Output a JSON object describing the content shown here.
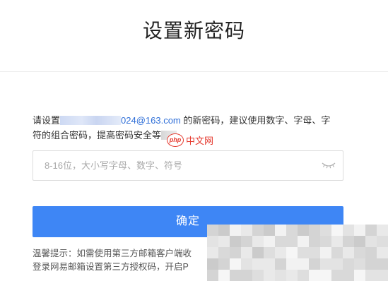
{
  "header": {
    "title": "设置新密码"
  },
  "description": {
    "prefix": "请设置",
    "email_visible_tail": "024@163.com",
    "line1_suffix": " 的新密码，建议使用数字、字母、字",
    "line2_text": "符的组合密码，提高密码安全等"
  },
  "watermark": {
    "logo": "php",
    "text": "中文网"
  },
  "password_field": {
    "placeholder": "8-16位，大小写字母、数字、符号",
    "value": "",
    "toggle_icon": "eye-closed-icon"
  },
  "confirm_button": {
    "label": "确定",
    "color": "#3e86f5"
  },
  "tip": {
    "line1": "温馨提示：如需使用第三方邮箱客户端收",
    "line2": "登录网易邮箱设置第三方授权码，开启P"
  }
}
